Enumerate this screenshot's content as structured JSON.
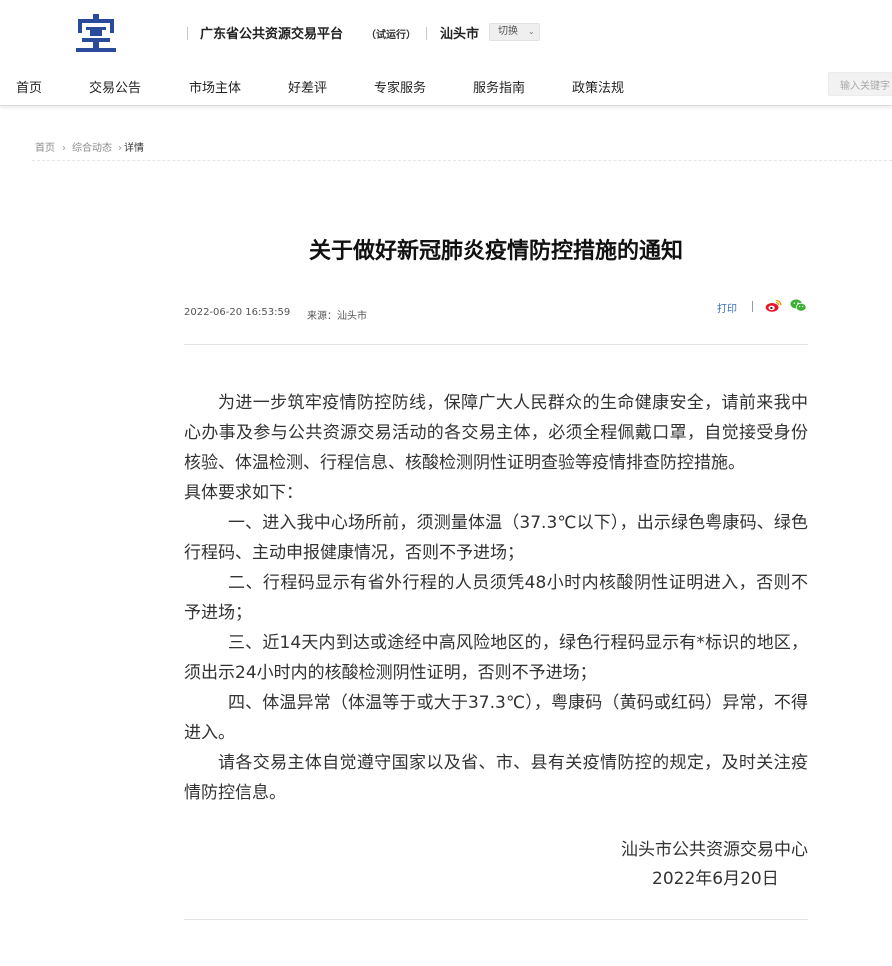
{
  "header": {
    "platform_name": "广东省公共资源交易平台",
    "platform_sub": "（试运行）",
    "city": "汕头市",
    "switch_label": "切换",
    "logo_color": "#2a4a9c"
  },
  "nav": {
    "items": [
      "首页",
      "交易公告",
      "市场主体",
      "好差评",
      "专家服务",
      "服务指南",
      "政策法规"
    ],
    "search_placeholder": "输入关键字"
  },
  "breadcrumb": {
    "home": "首页",
    "section": "综合动态",
    "current": "详情"
  },
  "article": {
    "title": "关于做好新冠肺炎疫情防控措施的通知",
    "date": "2022-06-20 16:53:59",
    "source": "来源：汕头市",
    "print_label": "打印",
    "share_icons": [
      "weibo-icon",
      "wechat-icon"
    ],
    "paragraphs": [
      "为进一步筑牢疫情防控防线，保障广大人民群众的生命健康安全，请前来我中心办事及参与公共资源交易活动的各交易主体，必须全程佩戴口罩，自觉接受身份核验、体温检测、行程信息、核酸检测阴性证明查验等疫情排查防控措施。",
      "具体要求如下：",
      "一、进入我中心场所前，须测量体温（37.3℃以下），出示绿色粤康码、绿色行程码、主动申报健康情况，否则不予进场；",
      "二、行程码显示有省外行程的人员须凭48小时内核酸阴性证明进入，否则不予进场；",
      "三、近14天内到达或途经中高风险地区的，绿色行程码显示有*标识的地区，须出示24小时内的核酸检测阴性证明，否则不予进场；",
      "四、体温异常（体温等于或大于37.3℃），粤康码（黄码或红码）异常，不得进入。",
      "请各交易主体自觉遵守国家以及省、市、县有关疫情防控的规定，及时关注疫情防控信息。"
    ],
    "signature_org": "汕头市公共资源交易中心",
    "signature_date": "2022年6月20日"
  }
}
